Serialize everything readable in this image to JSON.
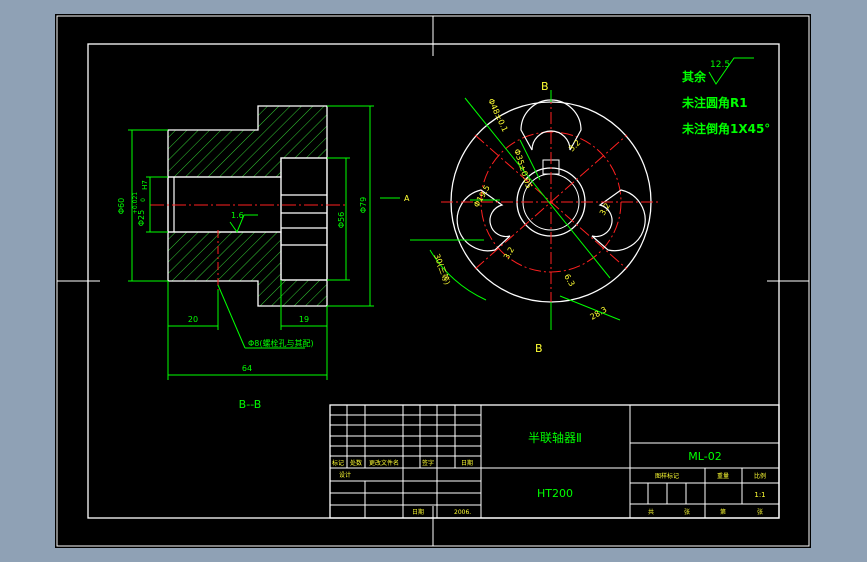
{
  "colors": {
    "background": "#8fa1b5",
    "sheet": "#000000",
    "border": "#ffffff",
    "dimension": "#00ff00",
    "center_line": "#ff2020",
    "text_yellow": "#ffff33",
    "hatch": "#33cc33"
  },
  "title_block": {
    "part_name": "半联轴器Ⅱ",
    "material": "HT200",
    "drawing_no": "ML-02",
    "scale": "1:1",
    "rev_headers": [
      "标记",
      "处数",
      "更改文件名",
      "签字",
      "日期"
    ],
    "row_design": "设计",
    "row_date": "日期",
    "date_value": "2006.",
    "right_headers": [
      "图样标记",
      "重量",
      "比例"
    ],
    "bottom_labels": [
      "共",
      "张",
      "第",
      "张"
    ]
  },
  "notes": {
    "roughness_value": "12.5",
    "rest_label": "其余",
    "fillet_note": "未注圆角R1",
    "chamfer_note": "未注倒角1X45°"
  },
  "section_view": {
    "section_label": "B--B",
    "dims": {
      "d60": "Φ60",
      "d25": "Φ25",
      "tol25_top": "+0.021",
      "tol25_bot": "0",
      "h7": "H7",
      "d56": "Φ56",
      "d79": "Φ79",
      "len20": "20",
      "len19": "19",
      "len64": "64",
      "hole_note": "Φ8(螺栓孔与其配)",
      "roughness_inner": "1.6",
      "view_mark": "A"
    }
  },
  "front_view": {
    "cut_label_top": "B",
    "cut_label_bottom": "B",
    "dims": {
      "r_outer": "Φ48±0.1",
      "r_mid": "Φ35±0.05",
      "bore": "Φ19.5",
      "groove_w": "28.3",
      "angle": "30(三等)",
      "rough_a": "3.2",
      "rough_b": "3.2",
      "rough_c": "3.2",
      "rough_d": "6.3"
    }
  }
}
